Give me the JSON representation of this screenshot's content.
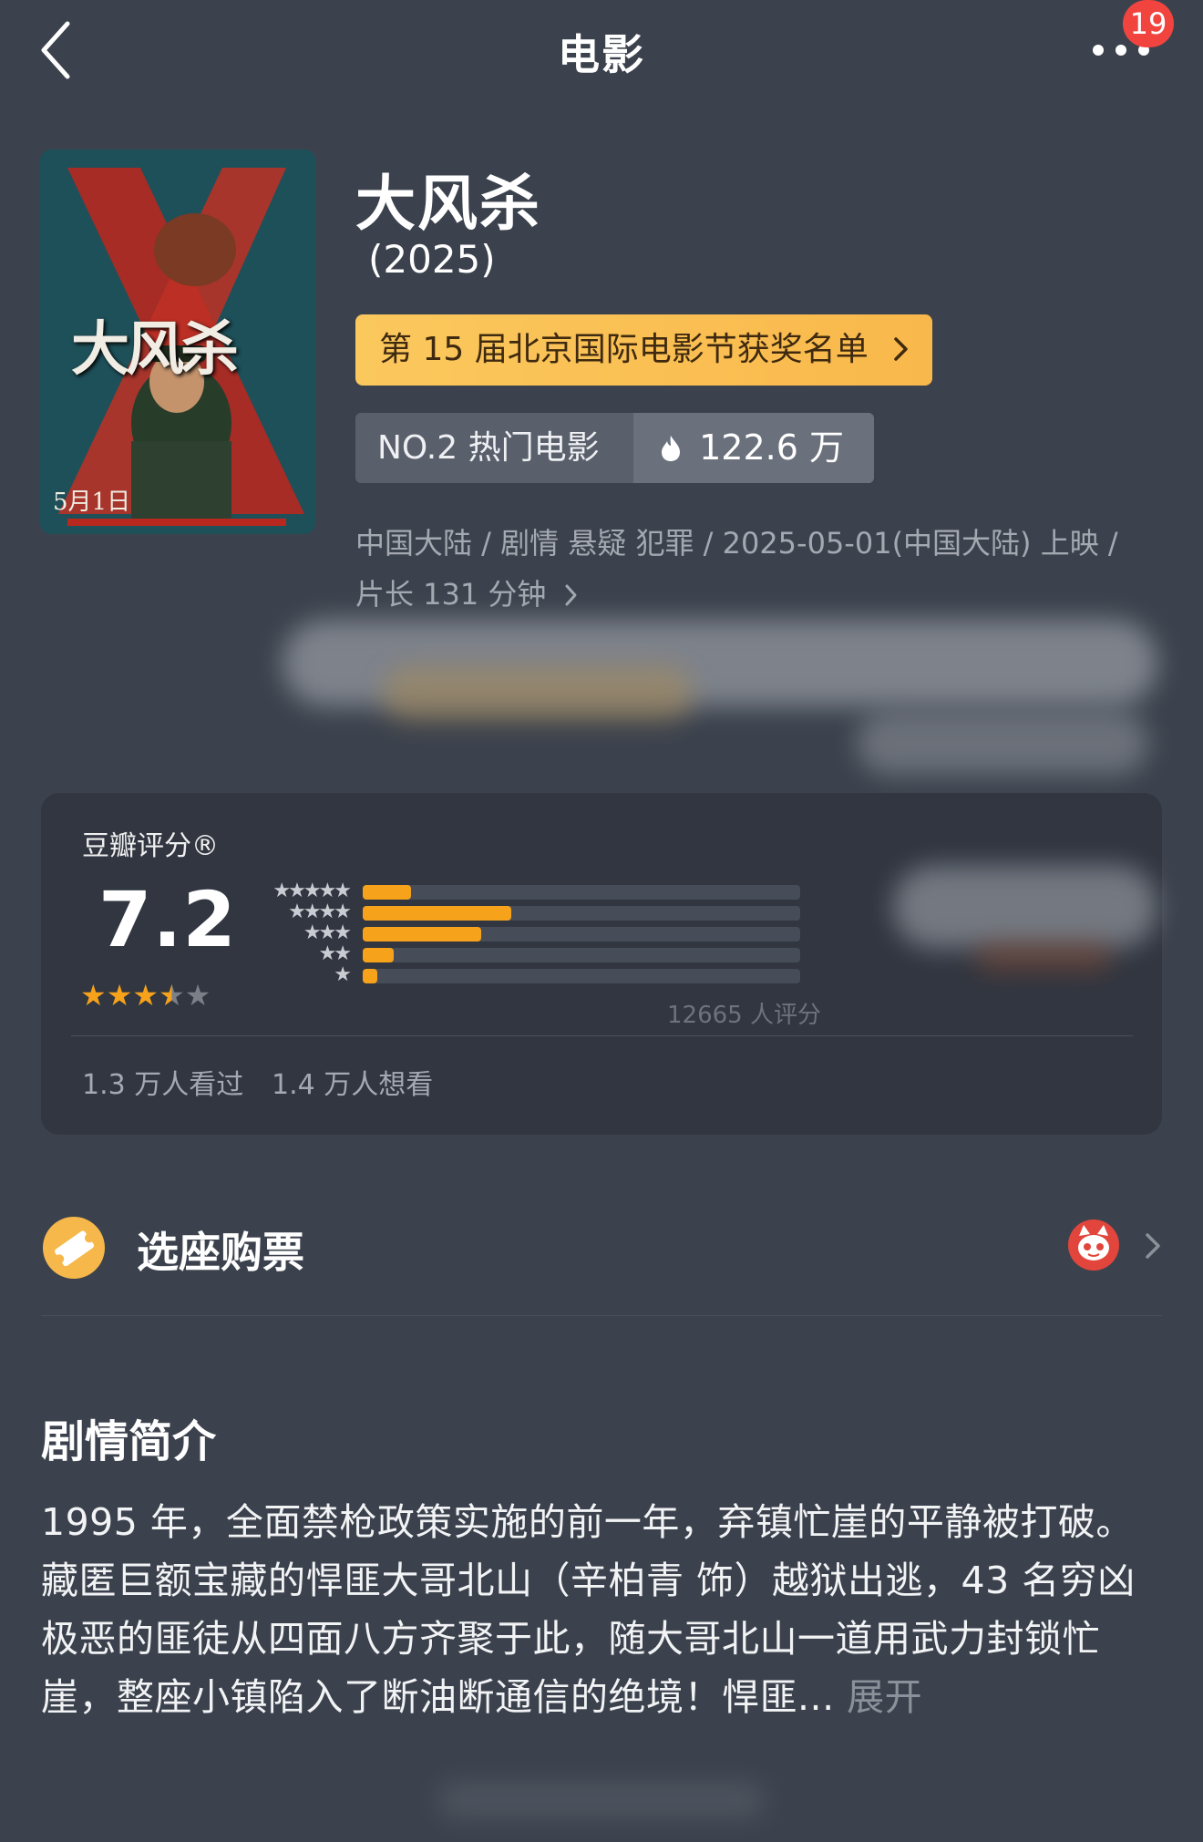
{
  "header": {
    "title": "电影",
    "badge_count": "19"
  },
  "movie": {
    "title": "大风杀",
    "year": "(2025)",
    "award_link": "第 15 届北京国际电影节获奖名单",
    "rank_label": "NO.2 热门电影",
    "heat_value": "122.6 万",
    "meta_line": "中国大陆 / 剧情 悬疑 犯罪 / 2025-05-01(中国大陆) 上映 /",
    "duration": "片长 131 分钟",
    "poster": {
      "title_text": "大风杀",
      "date_text": "5月1日",
      "icon": "movie-poster"
    }
  },
  "rating": {
    "label": "豆瓣评分®",
    "score": "7.2",
    "stars_value": 3.5,
    "stars_max": 5,
    "distribution": [
      {
        "stars": "★★★★★",
        "fraction": 0.11
      },
      {
        "stars": "★★★★",
        "fraction": 0.34
      },
      {
        "stars": "★★★",
        "fraction": 0.27
      },
      {
        "stars": "★★",
        "fraction": 0.07
      },
      {
        "stars": "★",
        "fraction": 0.03
      }
    ],
    "count_text": "12665 人评分",
    "seen": "1.3 万人看过",
    "want": "1.4 万人想看"
  },
  "ticket": {
    "label": "选座购票",
    "provider_icon": "maoyan-cat-icon"
  },
  "synopsis": {
    "title": "剧情简介",
    "text": "1995 年，全面禁枪政策实施的前一年，弃镇忙崖的平静被打破。藏匿巨额宝藏的悍匪大哥北山（辛柏青 饰）越狱出逃，43 名穷凶极恶的匪徒从四面八方齐聚于此，随大哥北山一道用武力封锁忙崖，整座小镇陷入了断油断通信的绝境！悍匪... ",
    "expand_label": "展开"
  },
  "colors": {
    "background": "#3c424d",
    "card": "#313640",
    "accent_orange": "#f7a21b",
    "award_gold": "#fbc85d",
    "badge_red": "#f2443f"
  }
}
